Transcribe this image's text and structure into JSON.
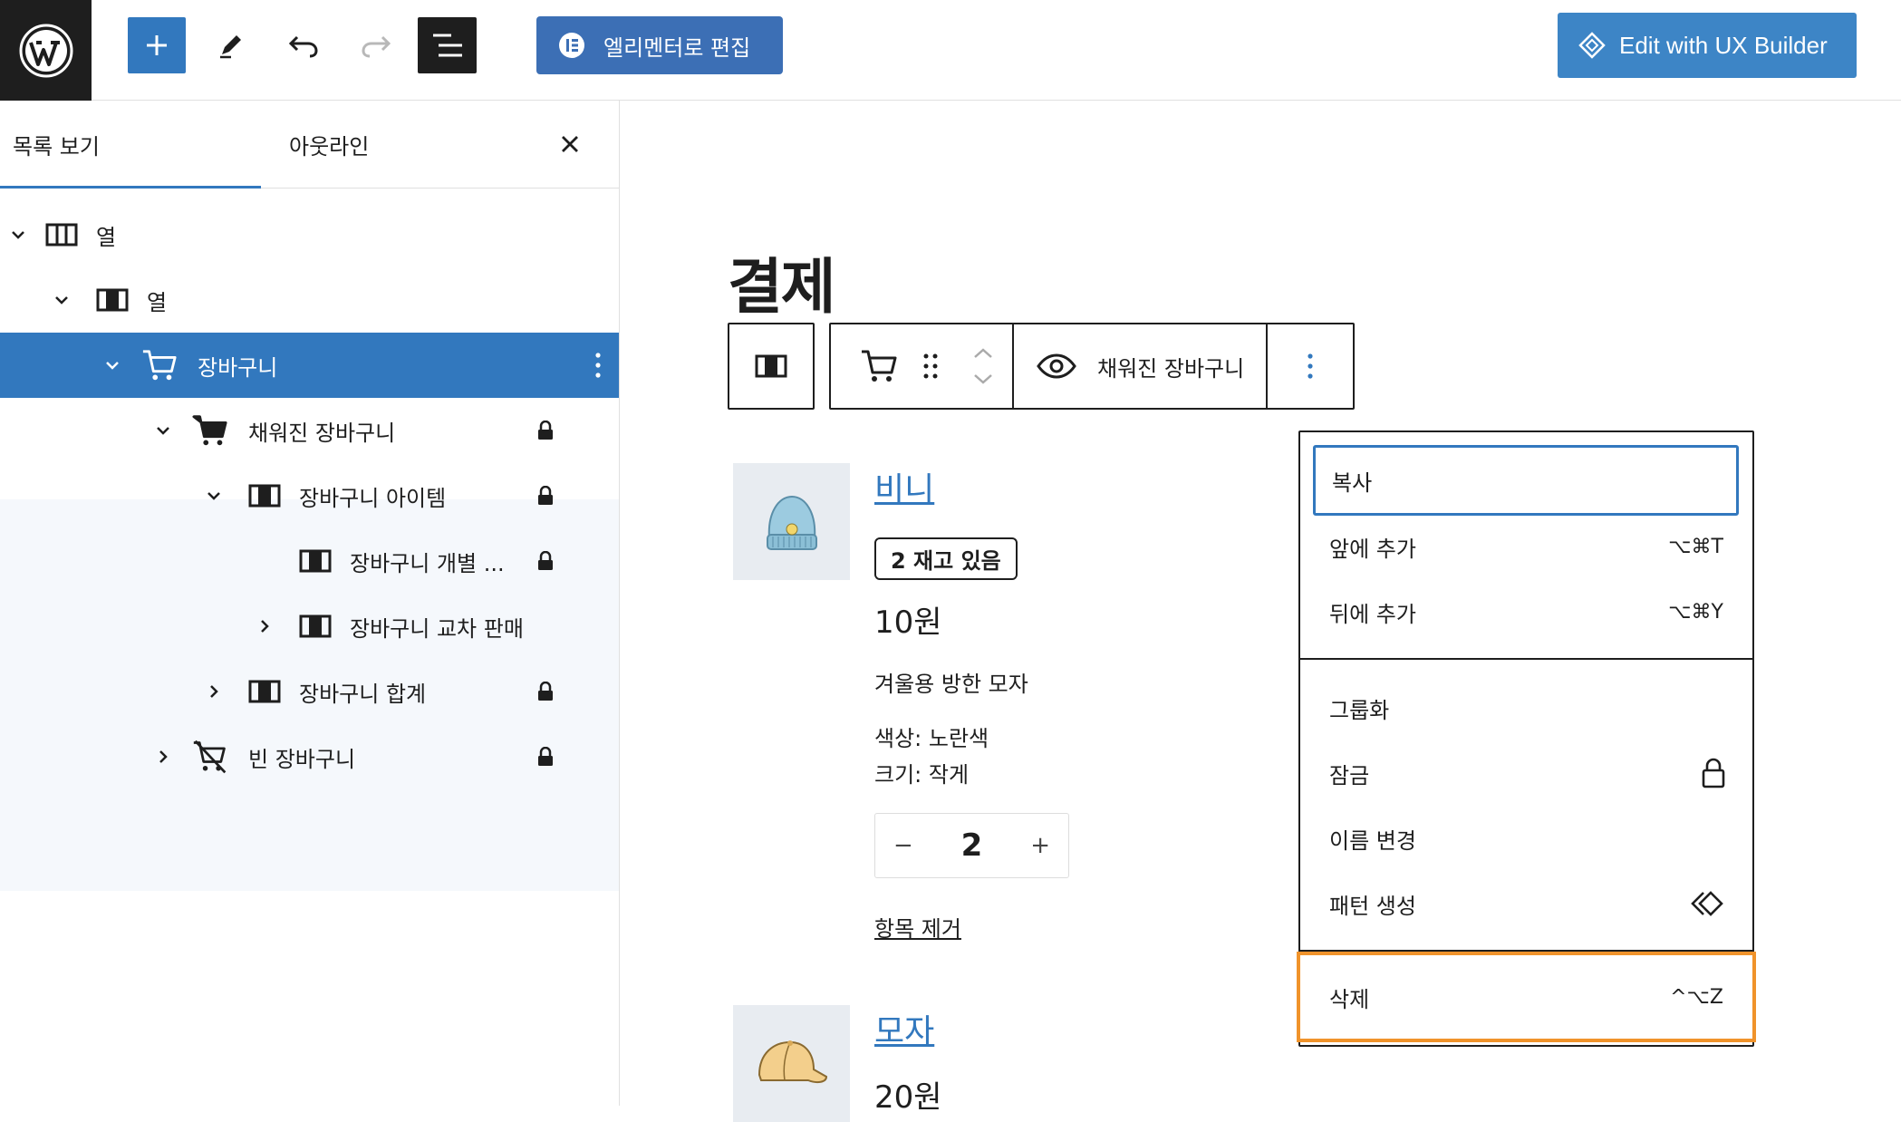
{
  "topbar": {
    "elementor_label": "엘리멘터로 편집",
    "ux_builder_label": "Edit with UX Builder"
  },
  "sidebar": {
    "tabs": [
      {
        "label": "목록 보기",
        "active": true
      },
      {
        "label": "아웃라인",
        "active": false
      }
    ],
    "tree": [
      {
        "label": "열",
        "icon": "columns-icon",
        "expanded": true
      },
      {
        "label": "열",
        "icon": "column-icon",
        "expanded": true
      },
      {
        "label": "장바구니",
        "icon": "cart-icon",
        "expanded": true,
        "selected": true
      },
      {
        "label": "채워진 장바구니",
        "icon": "filled-cart-icon",
        "expanded": true,
        "locked": true
      },
      {
        "label": "장바구니 아이템",
        "icon": "column-icon",
        "expanded": true,
        "locked": true
      },
      {
        "label": "장바구니 개별 ...",
        "icon": "column-icon",
        "locked": true
      },
      {
        "label": "장바구니 교차 판매",
        "icon": "column-icon",
        "expanded": false
      },
      {
        "label": "장바구니 합계",
        "icon": "column-icon",
        "expanded": false,
        "locked": true
      },
      {
        "label": "빈 장바구니",
        "icon": "empty-cart-icon",
        "expanded": false,
        "locked": true
      }
    ]
  },
  "canvas": {
    "page_title": "결제",
    "block_toolbar": {
      "view_label": "채워진 장바구니"
    },
    "products": [
      {
        "name": "비니",
        "stock": "2 재고 있음",
        "price": "10원",
        "description": "겨울용 방한 모자",
        "color": "색상: 노란색",
        "size": "크기: 작게",
        "quantity": "2",
        "remove_label": "항목 제거"
      },
      {
        "name": "모자",
        "price": "20원"
      }
    ]
  },
  "dropdown": {
    "items": [
      {
        "label": "복사",
        "shortcut": ""
      },
      {
        "label": "앞에 추가",
        "shortcut": "⌥⌘T"
      },
      {
        "label": "뒤에 추가",
        "shortcut": "⌥⌘Y"
      },
      {
        "label": "그룹화",
        "shortcut": ""
      },
      {
        "label": "잠금",
        "icon": "lock-icon"
      },
      {
        "label": "이름 변경",
        "shortcut": ""
      },
      {
        "label": "패턴 생성",
        "icon": "pattern-icon"
      },
      {
        "label": "삭제",
        "shortcut": "^⌥Z"
      }
    ]
  },
  "colors": {
    "accent": "#3278be",
    "highlight_border": "#f0932b",
    "dark": "#1e1e1e"
  }
}
